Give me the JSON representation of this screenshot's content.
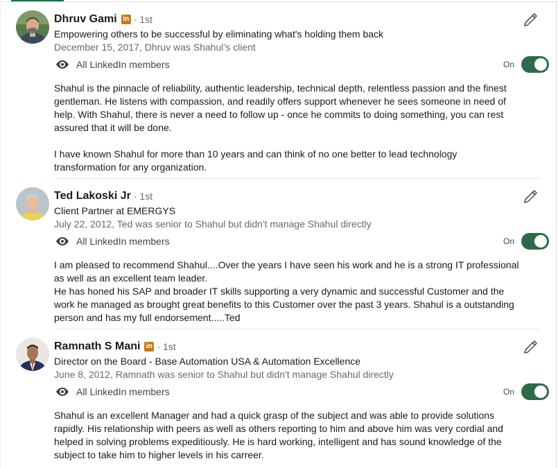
{
  "colors": {
    "accent": "#057642",
    "toggle_on": "#2c6b48",
    "linkedin_badge": "#c37d16"
  },
  "recommendations": [
    {
      "name": "Dhruv Gami",
      "badge_letters": "in",
      "degree": "· 1st",
      "headline": "Empowering others to be successful by eliminating what's holding them back",
      "meta": "December 15, 2017, Dhruv was Shahul’s client",
      "visibility": "All LinkedIn members",
      "toggle_label": "On",
      "body": "Shahul is the pinnacle of reliability, authentic leadership, technical depth, relentless passion and the finest gentleman. He listens with compassion, and readily offers support whenever he sees someone in need of help. With Shahul, there is never a need to follow up - once he commits to doing something, you can rest assured that it will be done.\n\nI have known Shahul for more than 10 years and can think of no one better to lead technology transformation for any organization."
    },
    {
      "name": "Ted Lakoski Jr",
      "degree": "· 1st",
      "headline": "Client Partner at EMERGYS",
      "meta": "July 22, 2012, Ted was senior to Shahul but didn't manage Shahul directly",
      "visibility": "All LinkedIn members",
      "toggle_label": "On",
      "body": "I am pleased to recommend Shahul....Over the years I have seen his work and he is a strong IT professional as well as an excellent team leader.\nHe has honed his SAP and broader IT skills supporting a very dynamic and successful Customer and the work he managed as brought great benefits to this Customer over the past 3 years. Shahul is a outstanding person and has my full endorsement.....Ted"
    },
    {
      "name": "Ramnath S Mani",
      "badge_letters": "in",
      "degree": "· 1st",
      "headline": "Director on the Board - Base Automation USA & Automation Excellence",
      "meta": "June 8, 2012, Ramnath was senior to Shahul but didn't manage Shahul directly",
      "visibility": "All LinkedIn members",
      "toggle_label": "On",
      "body": "Shahul is an excellent Manager and had a quick grasp of the subject and was able to provide solutions rapidly. His relationship with peers as well as others reporting to him and above him was very cordial and helped in solving problems expeditiously. He is hard working, intelligent and has sound knowledge of the subject to take him to higher levels in his carreer."
    }
  ]
}
